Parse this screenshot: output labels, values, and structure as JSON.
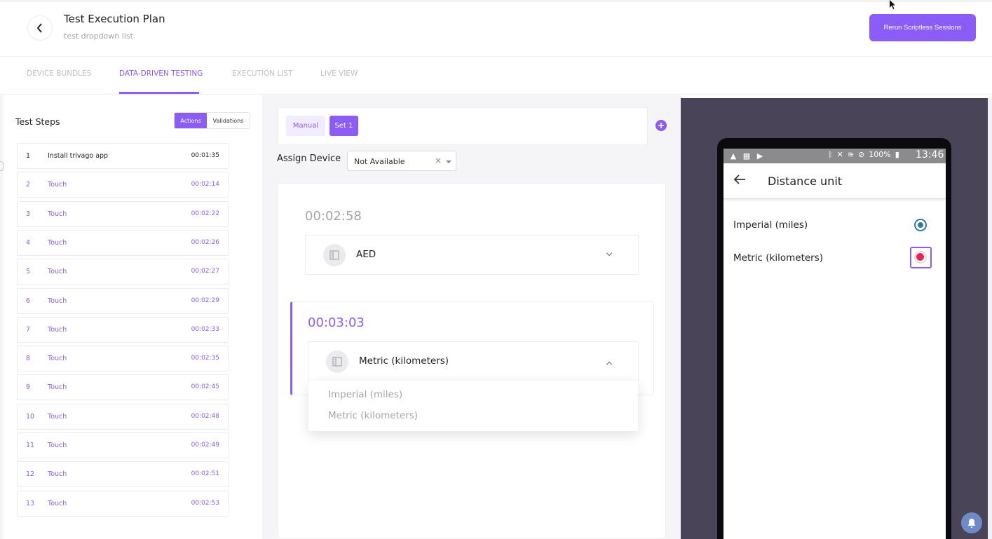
{
  "header": {
    "title": "Test Execution Plan",
    "subtitle": "test dropdown list",
    "rerun_label": "Rerun Scriptless Sessions"
  },
  "tabs": [
    {
      "label": "DEVICE BUNDLES",
      "active": false
    },
    {
      "label": "DATA-DRIVEN TESTING",
      "active": true
    },
    {
      "label": "EXECUTION LIST",
      "active": false
    },
    {
      "label": "LIVE VIEW",
      "active": false
    }
  ],
  "steps_panel": {
    "title": "Test Steps",
    "toggle": {
      "actions": "Actions",
      "validations": "Validations",
      "selected": "Actions"
    },
    "steps": [
      {
        "num": "1",
        "name": "Install trivago app",
        "time": "00:01:35",
        "done": true
      },
      {
        "num": "2",
        "name": "Touch",
        "time": "00:02:14",
        "done": false
      },
      {
        "num": "3",
        "name": "Touch",
        "time": "00:02:22",
        "done": false
      },
      {
        "num": "4",
        "name": "Touch",
        "time": "00:02:26",
        "done": false
      },
      {
        "num": "5",
        "name": "Touch",
        "time": "00:02:27",
        "done": false
      },
      {
        "num": "6",
        "name": "Touch",
        "time": "00:02:29",
        "done": false
      },
      {
        "num": "7",
        "name": "Touch",
        "time": "00:02:33",
        "done": false
      },
      {
        "num": "8",
        "name": "Touch",
        "time": "00:02:35",
        "done": false
      },
      {
        "num": "9",
        "name": "Touch",
        "time": "00:02:45",
        "done": false
      },
      {
        "num": "10",
        "name": "Touch",
        "time": "00:02:48",
        "done": false
      },
      {
        "num": "11",
        "name": "Touch",
        "time": "00:02:49",
        "done": false
      },
      {
        "num": "12",
        "name": "Touch",
        "time": "00:02:51",
        "done": false
      },
      {
        "num": "13",
        "name": "Touch",
        "time": "00:02:53",
        "done": false
      }
    ]
  },
  "data_sets": {
    "manual_label": "Manual",
    "set_label": "Set 1",
    "add_icon": "plus-icon"
  },
  "assign_device": {
    "label": "Assign Device",
    "value": "Not Available"
  },
  "entries": [
    {
      "time": "00:02:58",
      "value": "AED"
    },
    {
      "time": "00:03:03",
      "value": "Metric (kilometers)"
    }
  ],
  "dropdown_options": [
    "Imperial (miles)",
    "Metric (kilometers)"
  ],
  "device": {
    "battery": "100%",
    "clock": "13:46",
    "screen_title": "Distance unit",
    "options": [
      "Imperial (miles)",
      "Metric (kilometers)"
    ]
  },
  "colors": {
    "accent": "#8b5cf6",
    "device_bg": "#4a4458",
    "radio_blue": "#2e7aa8",
    "radio_red": "#e8245a"
  }
}
